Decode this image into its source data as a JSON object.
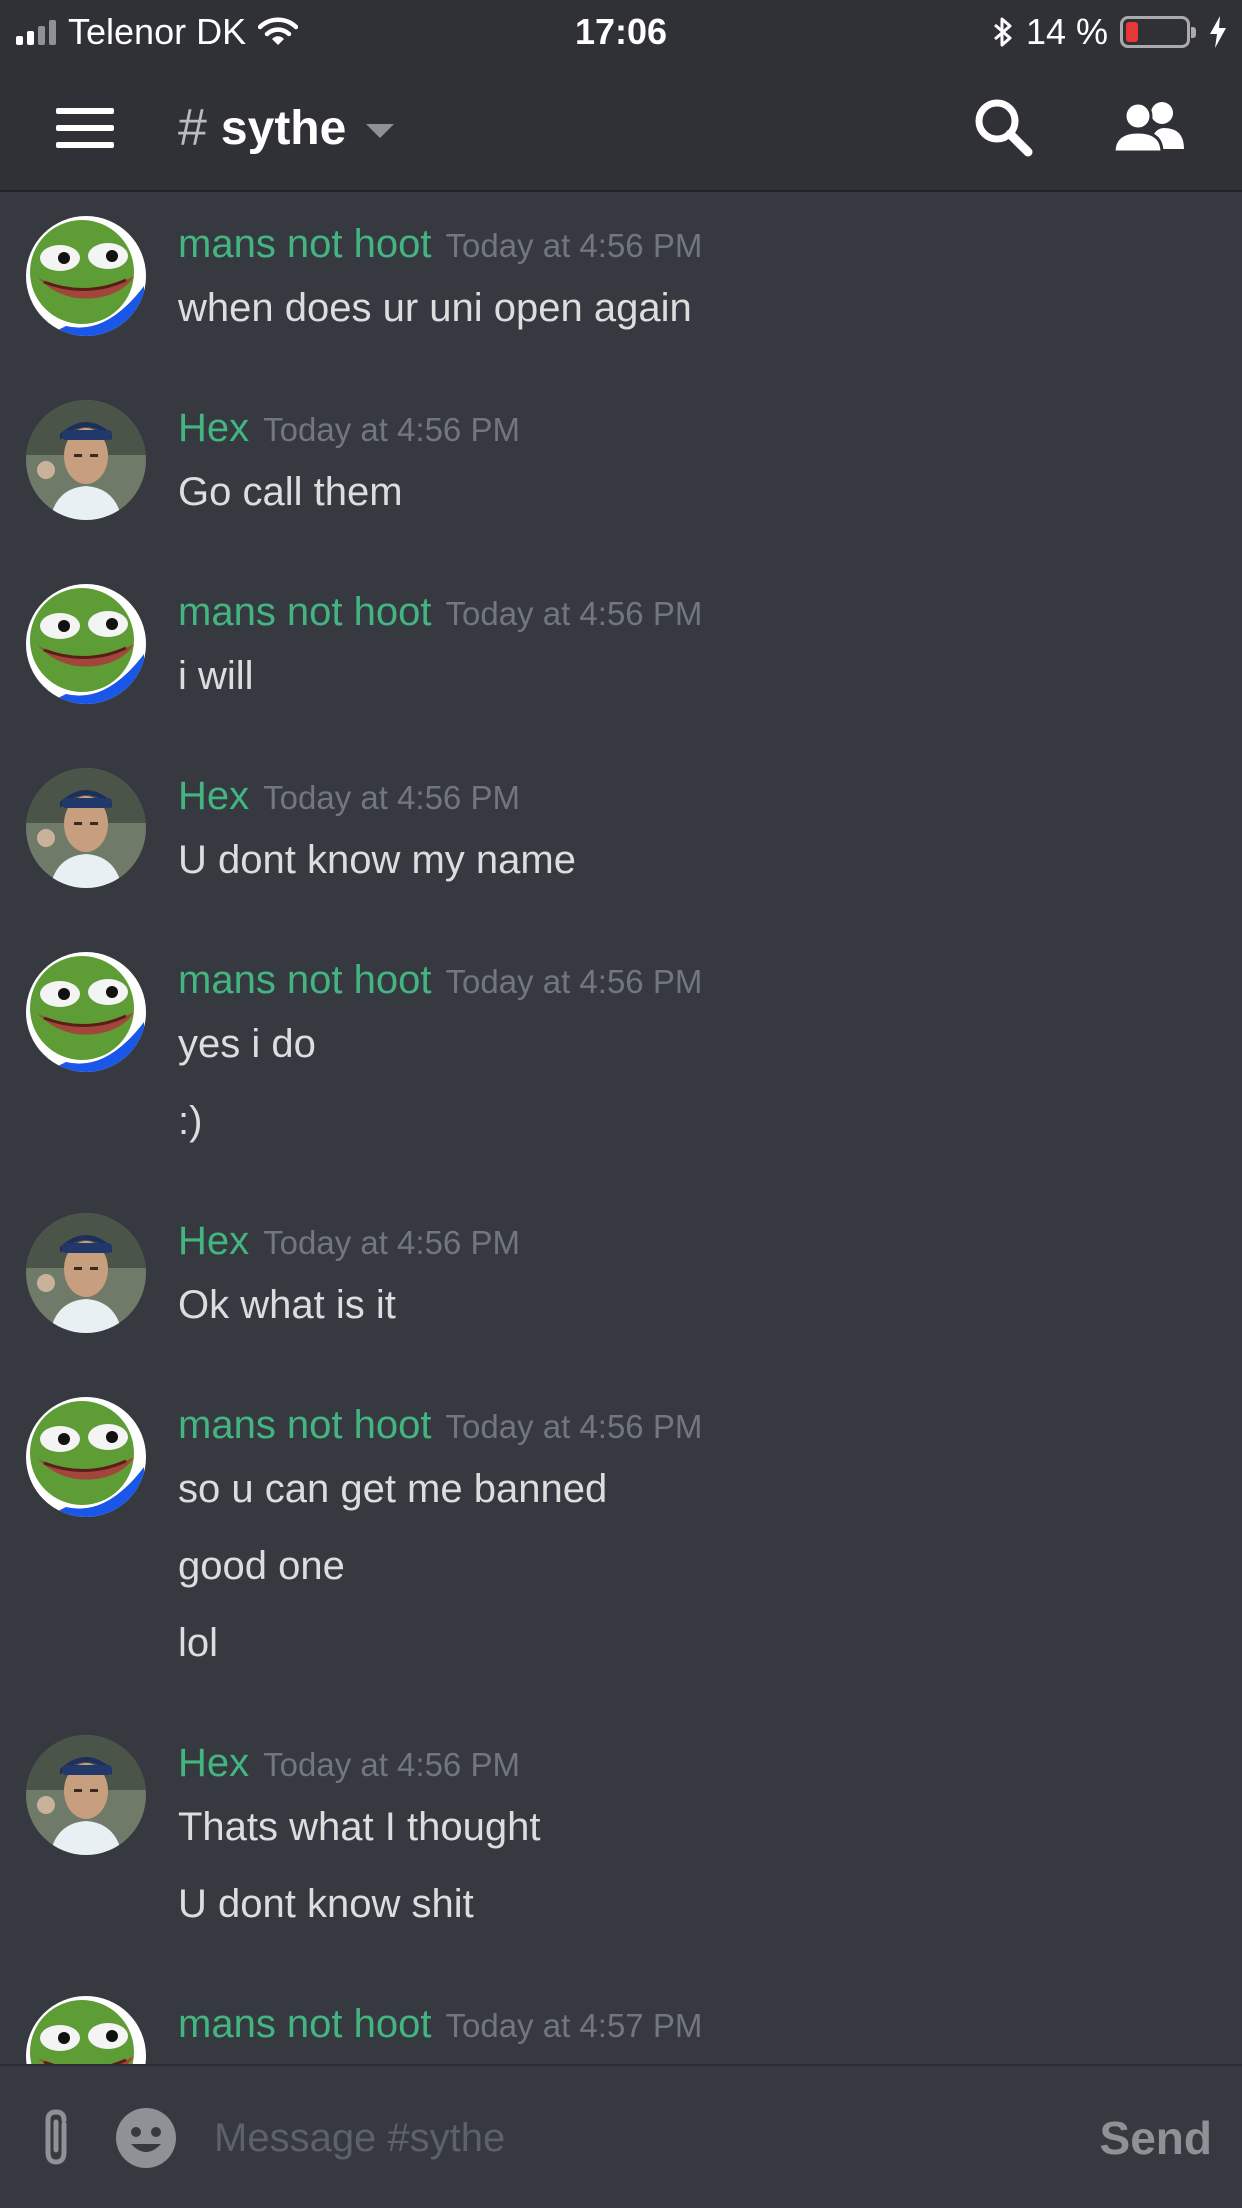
{
  "status_bar": {
    "carrier": "Telenor DK",
    "time": "17:06",
    "battery_percent": "14 %",
    "battery_level": 0.14,
    "icons": [
      "signal-icon",
      "wifi-icon",
      "bluetooth-icon",
      "battery-icon",
      "charging-icon"
    ]
  },
  "header": {
    "hash": "#",
    "channel_name": "sythe",
    "icons": [
      "menu-icon",
      "chevron-down-icon",
      "search-icon",
      "members-icon"
    ]
  },
  "colors": {
    "background": "#36393f",
    "header": "#2f3136",
    "username": "#43b581",
    "timestamp": "#72767d",
    "text": "#dcddde"
  },
  "messages": [
    {
      "author": "mans not hoot",
      "avatar": "pepe-avatar",
      "time": "Today at 4:56 PM",
      "lines": [
        "when does ur uni open again"
      ]
    },
    {
      "author": "Hex",
      "avatar": "photo-avatar",
      "time": "Today at 4:56 PM",
      "lines": [
        "Go call them"
      ]
    },
    {
      "author": "mans not hoot",
      "avatar": "pepe-avatar",
      "time": "Today at 4:56 PM",
      "lines": [
        "i will"
      ]
    },
    {
      "author": "Hex",
      "avatar": "photo-avatar",
      "time": "Today at 4:56 PM",
      "lines": [
        "U dont know my name"
      ]
    },
    {
      "author": "mans not hoot",
      "avatar": "pepe-avatar",
      "time": "Today at 4:56 PM",
      "lines": [
        "yes i do",
        ":)"
      ]
    },
    {
      "author": "Hex",
      "avatar": "photo-avatar",
      "time": "Today at 4:56 PM",
      "lines": [
        "Ok what is it"
      ]
    },
    {
      "author": "mans not hoot",
      "avatar": "pepe-avatar",
      "time": "Today at 4:56 PM",
      "lines": [
        "so u can get me banned",
        "good one",
        "lol"
      ]
    },
    {
      "author": "Hex",
      "avatar": "photo-avatar",
      "time": "Today at 4:56 PM",
      "lines": [
        "Thats what I thought",
        "U dont know shit"
      ]
    },
    {
      "author": "mans not hoot",
      "avatar": "pepe-avatar",
      "time": "Today at 4:57 PM",
      "lines": []
    }
  ],
  "composer": {
    "placeholder": "Message #sythe",
    "value": "",
    "send_label": "Send",
    "icons": [
      "attachment-icon",
      "emoji-icon"
    ]
  }
}
